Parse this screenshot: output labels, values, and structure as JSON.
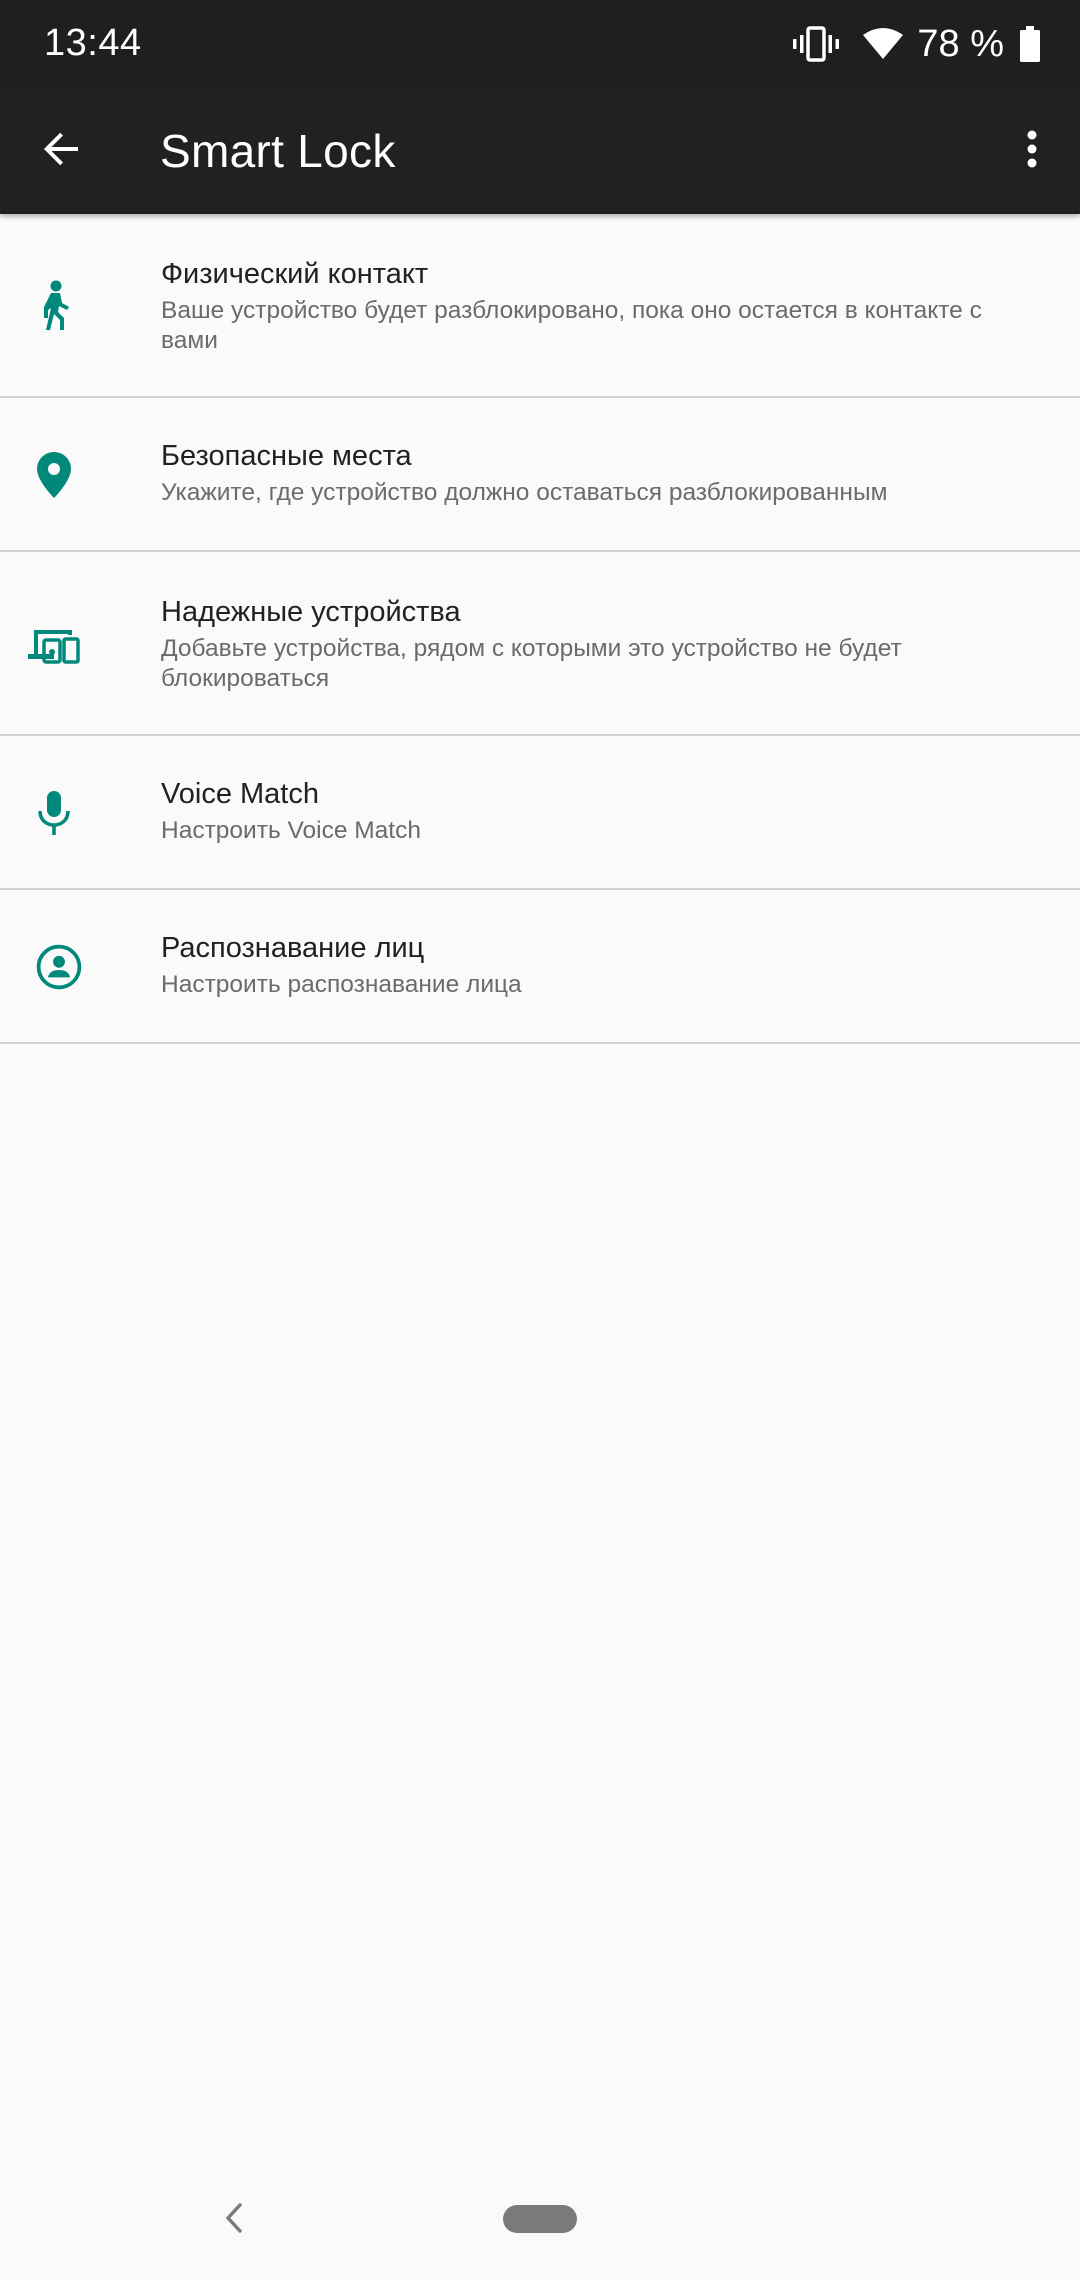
{
  "status_bar": {
    "time": "13:44",
    "battery_text": "78 %",
    "icons": [
      "vibrate-icon",
      "wifi-icon",
      "battery-icon"
    ]
  },
  "app_bar": {
    "title": "Smart Lock",
    "back_icon": "arrow-back-icon",
    "more_icon": "more-vert-icon"
  },
  "accent_color": "#00897b",
  "items": [
    {
      "title": "Физический контакт",
      "subtitle": "Ваше устройство будет разблокировано, пока оно остается в контакте с вами",
      "icon": "walking-person-icon"
    },
    {
      "title": "Безопасные места",
      "subtitle": "Укажите, где устройство должно оставаться разблокированным",
      "icon": "location-pin-icon"
    },
    {
      "title": "Надежные устройства",
      "subtitle": "Добавьте устройства, рядом с которыми это устройство не будет блокироваться",
      "icon": "devices-icon"
    },
    {
      "title": "Voice Match",
      "subtitle": "Настроить Voice Match",
      "icon": "microphone-icon"
    },
    {
      "title": "Распознавание лиц",
      "subtitle": "Настроить распознавание лица",
      "icon": "face-account-icon"
    }
  ],
  "nav_bar": {
    "icons": [
      "nav-back-icon",
      "home-pill"
    ]
  }
}
